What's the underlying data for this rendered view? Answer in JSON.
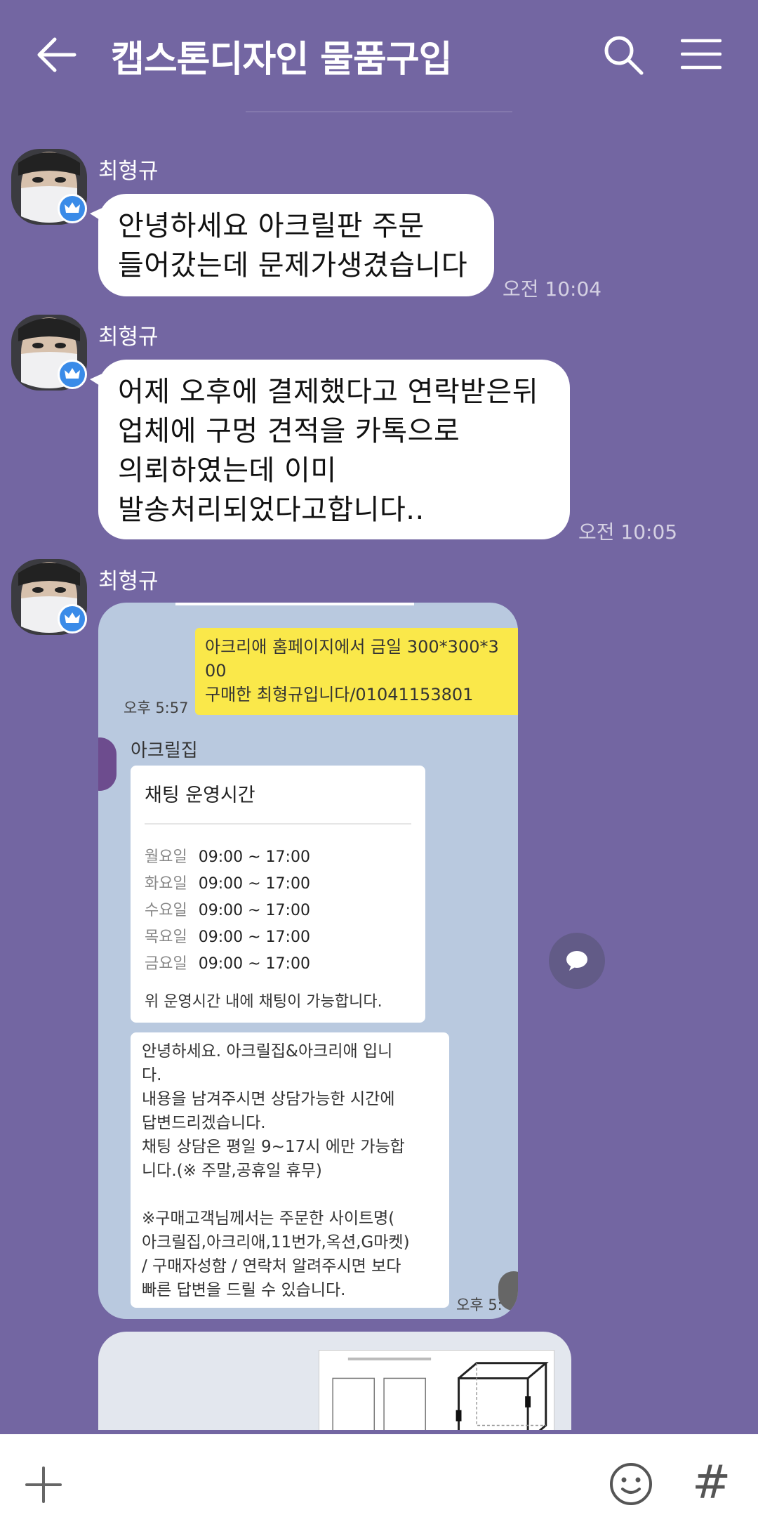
{
  "header": {
    "title": "캡스톤디자인 물품구입",
    "back_icon": "arrow-left-icon",
    "search_icon": "search-icon",
    "menu_icon": "hamburger-menu-icon"
  },
  "messages": [
    {
      "sender": "최형규",
      "text": "안녕하세요 아크릴판 주문\n들어갔는데 문제가생겼습니다",
      "time": "오전 10:04"
    },
    {
      "sender": "최형규",
      "text": "어제 오후에 결제했다고 연락받은뒤\n업체에 구멍 견적을 카톡으로\n의뢰하였는데 이미\n발송처리되었다고합니다..",
      "time": "오전 10:05"
    },
    {
      "sender": "최형규",
      "screenshot": {
        "yellow_message": "아크리애 홈페이지에서 금일  300*300*3\n00\n구매한 최형규입니다/01041153801",
        "yellow_time": "오후 5:57",
        "shop_name": "아크릴집",
        "hours_title": "채팅 운영시간",
        "hours": [
          {
            "day": "월요일",
            "time": "09:00 ~ 17:00"
          },
          {
            "day": "화요일",
            "time": "09:00 ~ 17:00"
          },
          {
            "day": "수요일",
            "time": "09:00 ~ 17:00"
          },
          {
            "day": "목요일",
            "time": "09:00 ~ 17:00"
          },
          {
            "day": "금요일",
            "time": "09:00 ~ 17:00"
          }
        ],
        "hours_note": "위 운영시간 내에 채팅이 가능합니다.",
        "greeting": "안녕하세요. 아크릴집&아크리애 입니\n다.\n내용을 남겨주시면 상담가능한 시간에\n답변드리겠습니다.\n채팅 상담은 평일 9~17시 에만 가능합\n니다.(※ 주말,공휴일 휴무)\n\n※구매고객님께서는 주문한 사이트명(\n아크릴집,아크리애,11번가,옥션,G마켓)\n/ 구매자성함 / 연락처 알려주시면 보다\n 빠른 답변을 드릴 수 있습니다.",
        "greeting_time": "오후 5:"
      }
    }
  ],
  "input_bar": {
    "plus_icon": "plus-icon",
    "emoji_icon": "emoji-icon",
    "hash_label": "#"
  },
  "colors": {
    "background": "#7366a2",
    "bubble": "#ffffff",
    "yellow": "#fae84a",
    "crown_badge": "#3a8be8"
  }
}
